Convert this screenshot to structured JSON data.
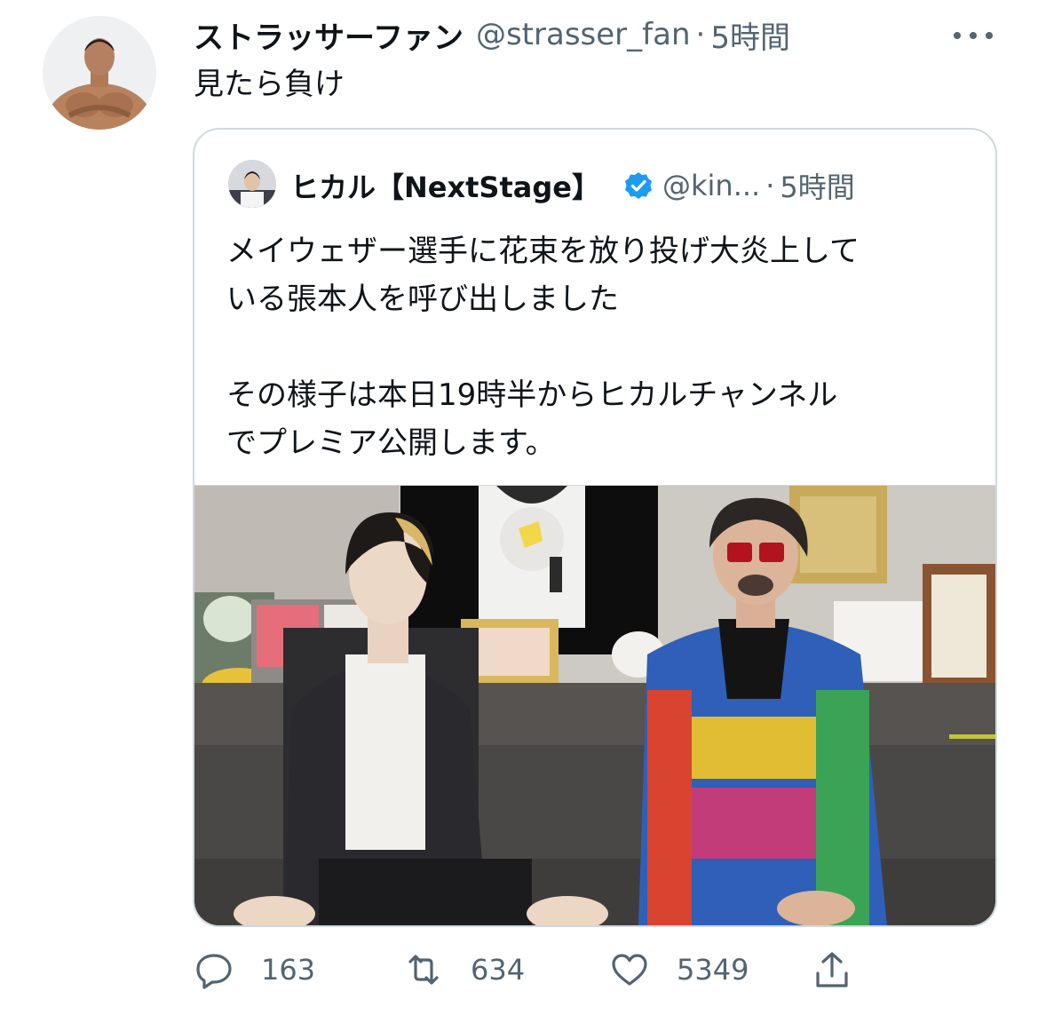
{
  "tweet": {
    "display_name": "ストラッサーファン",
    "handle": "@strasser_fan",
    "separator": "·",
    "time": "5時間",
    "text": "見たら負け"
  },
  "quoted_tweet": {
    "display_name": "ヒカル【NextStage】",
    "handle": "@kin...",
    "separator": "·",
    "time": "5時間",
    "text_line1": "メイウェザー選手に花束を放り投げ大炎上して",
    "text_line2": "いる張本人を呼び出しました",
    "text_line3": "その様子は本日19時半からヒカルチャンネル",
    "text_line4": "でプレミア公開します。"
  },
  "actions": {
    "replies": "163",
    "retweets": "634",
    "likes": "5349"
  },
  "icons": {
    "more": "more-horizontal-icon",
    "verified": "verified-badge-icon",
    "reply": "reply-icon",
    "retweet": "retweet-icon",
    "like": "heart-icon",
    "share": "share-icon"
  },
  "colors": {
    "text_primary": "#0f1419",
    "text_secondary": "#536471",
    "border": "#cfd9de",
    "verified": "#1d9bf0"
  }
}
